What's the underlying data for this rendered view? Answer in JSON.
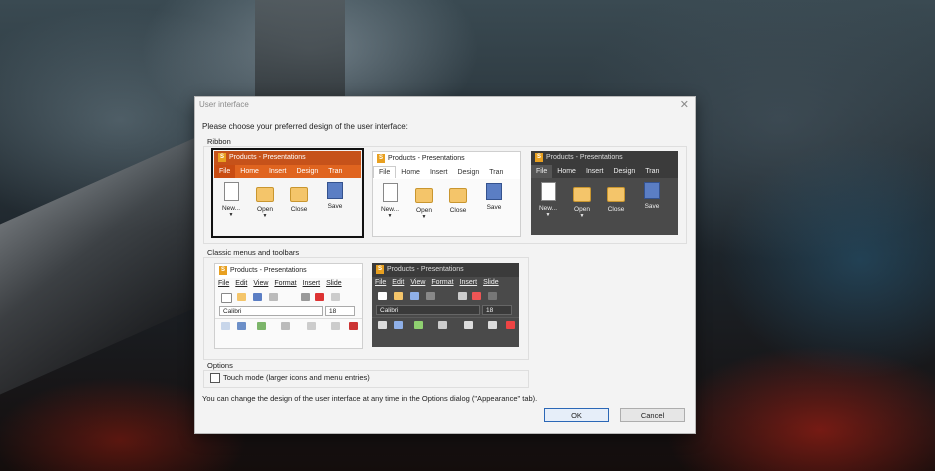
{
  "dialog": {
    "title": "User interface",
    "prompt": "Please choose your preferred design of the user interface:",
    "ribbon_label": "Ribbon",
    "classic_label": "Classic menus and toolbars",
    "options_label": "Options",
    "touch_mode_label": "Touch mode (larger icons and menu entries)",
    "touch_mode_checked": false,
    "footer": "You can change the design of the user interface at any time in the Options dialog (\"Appearance\" tab).",
    "ok_label": "OK",
    "cancel_label": "Cancel"
  },
  "preview_common": {
    "app_title": "Products - Presentations",
    "logo_letter": "S",
    "ribbon_tabs": [
      "File",
      "Home",
      "Insert",
      "Design",
      "Tran"
    ],
    "ribbon_buttons": [
      {
        "label": "New...",
        "icon": "new-document-icon"
      },
      {
        "label": "Open",
        "icon": "folder-open-icon"
      },
      {
        "label": "Close",
        "icon": "folder-close-icon"
      },
      {
        "label": "Save",
        "icon": "save-disk-icon"
      }
    ],
    "classic_menus": [
      "File",
      "Edit",
      "View",
      "Format",
      "Insert",
      "Slide"
    ],
    "font_name": "Calibri",
    "font_size": "18"
  },
  "colors": {
    "orange_title": "#c6521a",
    "orange_tab": "#e0641f",
    "dark_bg": "#4a4a4a",
    "dark_title": "#3b3b3b",
    "accent_ok": "#2b67b6"
  }
}
